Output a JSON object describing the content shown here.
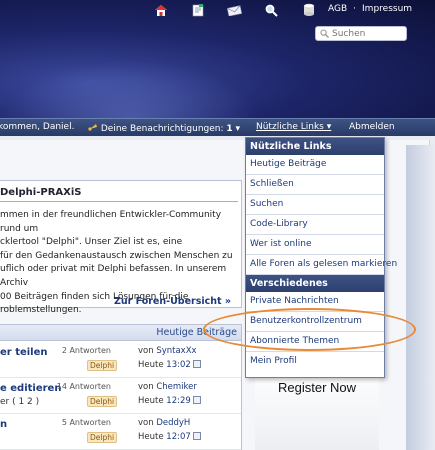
{
  "header": {
    "icons": [
      "home-icon",
      "notes-icon",
      "mail-icon",
      "search-icon",
      "database-icon"
    ],
    "links": [
      "AGB",
      "·",
      "Impressum"
    ],
    "search_placeholder": "Suchen"
  },
  "navbar": {
    "welcome": "kommen, Daniel.",
    "notifications_label": "Deine Benachrichtigungen:",
    "notifications_count": "1",
    "useful_links": "Nützliche Links",
    "logout": "Abmelden"
  },
  "welcome_box": {
    "title": "Delphi-PRAXiS",
    "lines": [
      "mmen in der freundlichen Entwickler-Community rund um",
      "cklertool \"Delphi\". Unser Ziel ist es, eine",
      "für den Gedankenaustausch zwischen Menschen zu",
      "uflich oder privat mit Delphi befassen. In unserem Archiv",
      "00 Beiträgen finden sich Lösungen für die",
      "roblemstellungen."
    ],
    "link": "Zur Foren-Übersicht »"
  },
  "posts": {
    "header": "Heutige Beiträge",
    "rows": [
      {
        "title": "er teilen",
        "pages": "",
        "answers": "2 Antworten",
        "badge": "Delphi",
        "by_prefix": "von",
        "author": "SyntaxXx",
        "date": "Heute",
        "time": "13:02"
      },
      {
        "title": "e editieren",
        "pages": "er (  1 2 )",
        "answers": "14 Antworten",
        "badge": "Delphi",
        "by_prefix": "von",
        "author": "Chemiker",
        "date": "Heute",
        "time": "12:29"
      },
      {
        "title": "n",
        "pages": "",
        "answers": "5 Antworten",
        "badge": "Delphi",
        "by_prefix": "von",
        "author": "DeddyH",
        "date": "Heute",
        "time": "12:07"
      }
    ]
  },
  "register": {
    "label": "Register Now"
  },
  "dropdown": {
    "section1_title": "Nützliche Links",
    "section1_items": [
      "Heutige Beiträge",
      "Schließen",
      "Suchen",
      "Code-Library",
      "Wer ist online",
      "Alle Foren als gelesen markieren"
    ],
    "section2_title": "Verschiedenes",
    "section2_items": [
      "Private Nachrichten",
      "Benutzerkontrollzentrum",
      "Abonnierte Themen",
      "Mein Profil"
    ]
  },
  "colors": {
    "nav": "#2f4270",
    "link": "#1c3a7c",
    "highlight": "#e88a36",
    "badge_bg": "#f8e6bf"
  }
}
